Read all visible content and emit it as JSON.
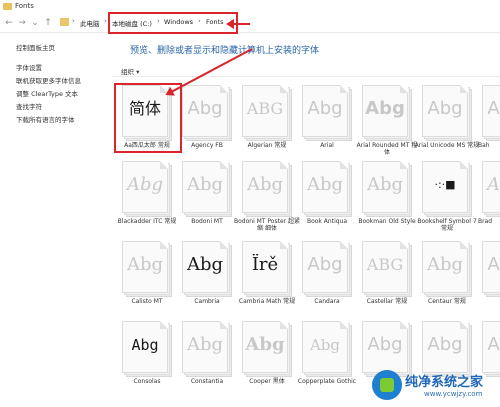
{
  "window": {
    "title": "Fonts"
  },
  "address": {
    "back": "←",
    "forward": "→",
    "dropdown": "⌄",
    "up": "↑",
    "crumbs": [
      "此电脑",
      "本地磁盘 (C:)",
      "Windows",
      "Fonts"
    ],
    "sep": "›"
  },
  "sidebar": {
    "items": [
      "控制面板主页",
      "字体设置",
      "联机获取更多字体信息",
      "调整 ClearType 文本",
      "查找字符",
      "下载所有语言的字体"
    ]
  },
  "main": {
    "heading": "预览、删除或者显示和隐藏计算机上安装的字体",
    "organize": "组织 ▾"
  },
  "fonts": [
    {
      "sample": "简体",
      "label": "Aa西瓜太郎 常规"
    },
    {
      "sample": "Abg",
      "label": "Agency FB"
    },
    {
      "sample": "ABG",
      "label": "Algerian 常规"
    },
    {
      "sample": "Abg",
      "label": "Arial"
    },
    {
      "sample": "Abg",
      "label": "Arial Rounded MT 粗体"
    },
    {
      "sample": "Abg",
      "label": "Arial Unicode MS 常规"
    },
    {
      "sample": "Abg",
      "label": "Bah"
    },
    {
      "sample": "Abg",
      "label": "Blackadder ITC 常规"
    },
    {
      "sample": "Abg",
      "label": "Bodoni MT"
    },
    {
      "sample": "Abg",
      "label": "Bodoni MT Poster 超紧缩 细体"
    },
    {
      "sample": "Abg",
      "label": "Book Antiqua"
    },
    {
      "sample": "Abg",
      "label": "Bookman Old Style"
    },
    {
      "sample": "·:·■",
      "label": "Bookshelf Symbol 7 常规"
    },
    {
      "sample": "Abg",
      "label": "Brad"
    },
    {
      "sample": "Abg",
      "label": "Calisto MT"
    },
    {
      "sample": "Abg",
      "label": "Cambria"
    },
    {
      "sample": "Ïrě",
      "label": "Cambria Math 常规"
    },
    {
      "sample": "Abg",
      "label": "Candara"
    },
    {
      "sample": "ABG",
      "label": "Castellar 常规"
    },
    {
      "sample": "Abg",
      "label": "Centaur 常规"
    },
    {
      "sample": "Abg",
      "label": ""
    },
    {
      "sample": "Abg",
      "label": "Consolas"
    },
    {
      "sample": "Abg",
      "label": "Constantia"
    },
    {
      "sample": "Abg",
      "label": "Cooper 黑体"
    },
    {
      "sample": "Abg",
      "label": "Copperplate Gothic"
    },
    {
      "sample": "Abg",
      "label": ""
    },
    {
      "sample": "Abg",
      "label": ""
    },
    {
      "sample": "Abg",
      "label": ""
    }
  ],
  "watermark": {
    "title": "纯净系统之家",
    "url": "www.ycwjzy.com"
  }
}
